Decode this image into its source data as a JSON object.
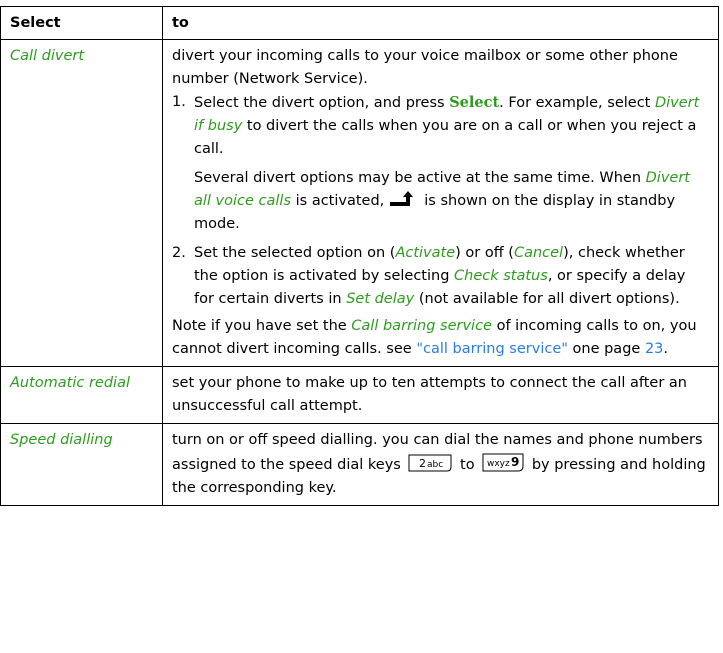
{
  "table": {
    "header": {
      "col1": "Select",
      "col2": "to"
    },
    "rows": [
      {
        "name": "Call divert",
        "intro": "divert your incoming calls to your voice mailbox or some other phone number (Network Service).",
        "step1": {
          "num": "1.",
          "t1": "Select the divert option, and press ",
          "select_key": "Select",
          "t2": ". For example, select ",
          "option": "Divert if busy",
          "t3": " to divert the calls when you are on a call or when you reject a call."
        },
        "step1_note": {
          "t1": "Several divert options may be active at the same time. When ",
          "option": "Divert all voice calls",
          "t2": " is activated,",
          "icon": "divert-active-icon",
          "t3": "is shown on the display in standby mode."
        },
        "step2": {
          "num": "2.",
          "t1": "Set the selected option on (",
          "activate": "Activate",
          "t2": ") or off (",
          "cancel": "Cancel",
          "t3": "), check whether the option is activated by selecting ",
          "check_status": "Check status",
          "t4": ", or specify a delay for certain diverts in ",
          "set_delay": "Set delay",
          "t5": " (not available for all divert options)."
        },
        "note": {
          "t1": "Note if you have set the ",
          "barring": "Call barring service",
          "t2": " of incoming calls to on, you cannot divert incoming calls. see ",
          "link": "\"call barring service\"",
          "t3": " one page ",
          "page": "23",
          "t4": "."
        }
      },
      {
        "name": "Automatic redial",
        "desc": "set your phone to make up to ten attempts to connect the call after an unsuccessful call attempt."
      },
      {
        "name": "Speed dialling",
        "t1": "turn on or off speed dialling. you can dial the names and phone numbers assigned to the speed dial keys",
        "key_2": {
          "digit": "2",
          "letters": "abc"
        },
        "t2": "to",
        "key_9": {
          "digit": "9",
          "letters": "wxyz"
        },
        "t3": "by pressing and holding the corresponding key."
      }
    ]
  },
  "colors": {
    "menu_item": "#2e9c1f",
    "link": "#2a7de1",
    "border": "#000000"
  }
}
